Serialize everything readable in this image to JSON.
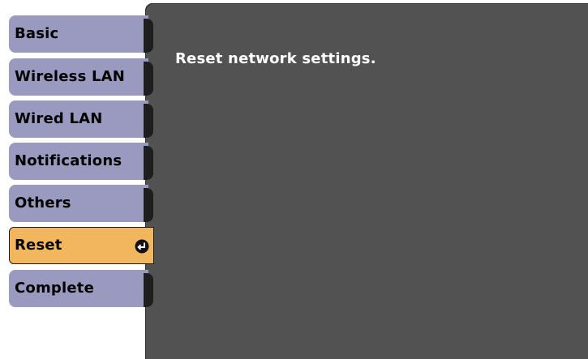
{
  "sidebar": {
    "items": [
      {
        "label": "Basic",
        "active": false
      },
      {
        "label": "Wireless LAN",
        "active": false
      },
      {
        "label": "Wired LAN",
        "active": false
      },
      {
        "label": "Notifications",
        "active": false
      },
      {
        "label": "Others",
        "active": false
      },
      {
        "label": "Reset",
        "active": true,
        "icon": "enter-icon"
      },
      {
        "label": "Complete",
        "active": false
      }
    ]
  },
  "main": {
    "description": "Reset network settings."
  },
  "colors": {
    "tab_inactive": "#9a9ac0",
    "tab_active": "#f2b65f",
    "panel": "#525252"
  }
}
